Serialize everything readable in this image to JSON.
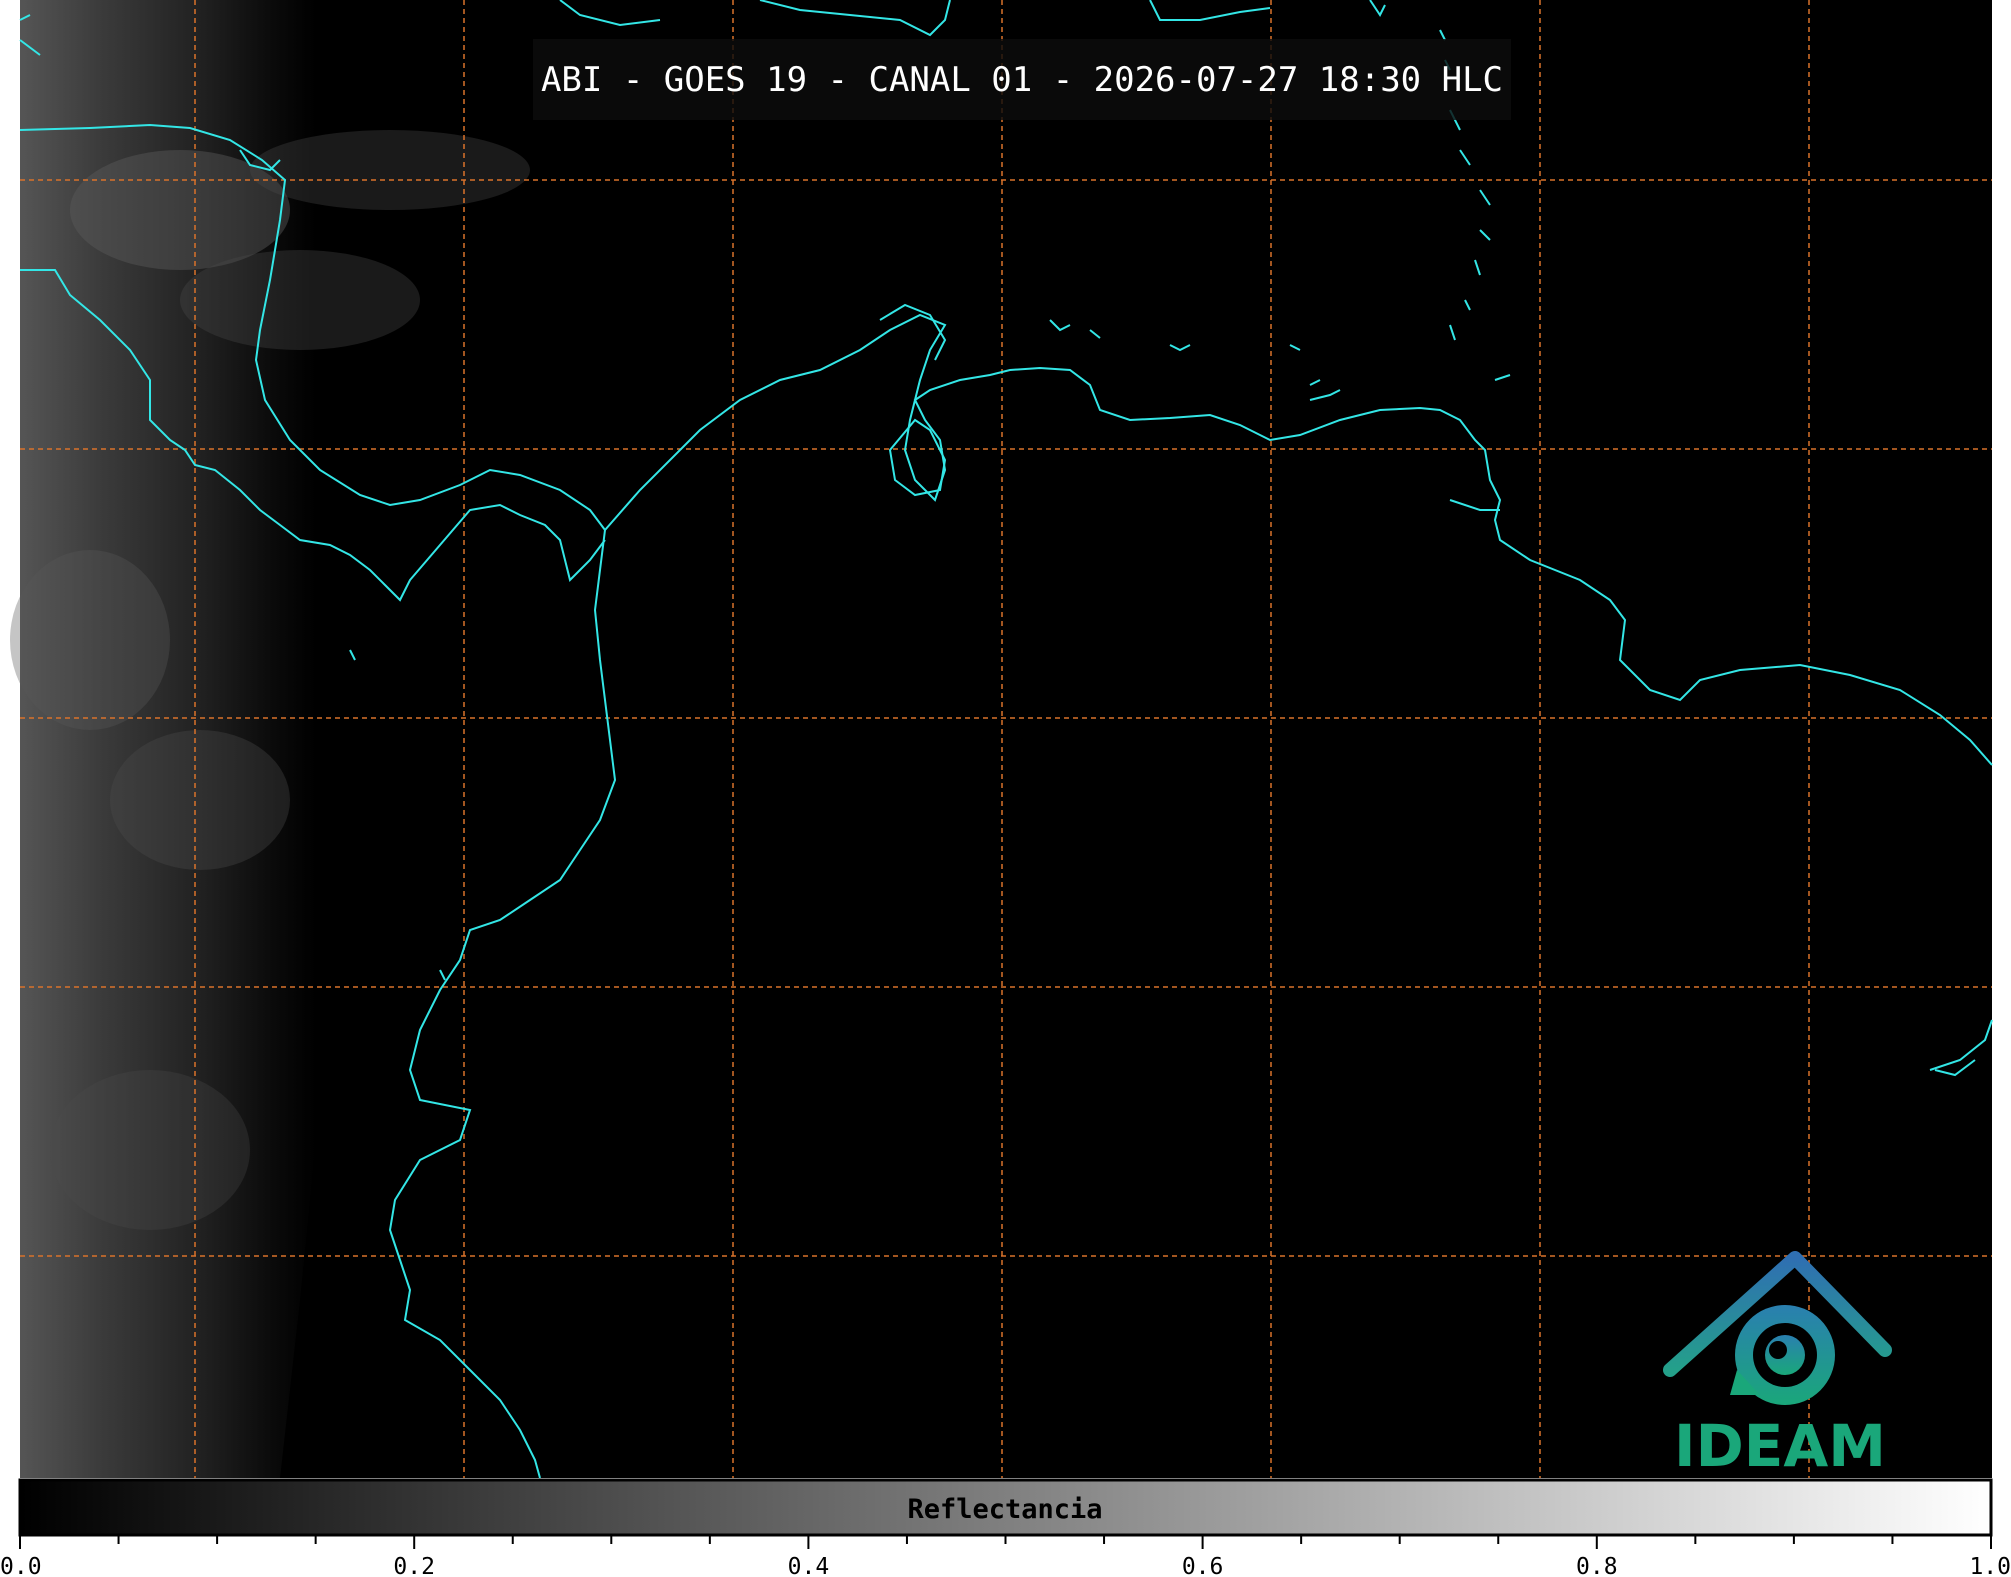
{
  "title": "ABI - GOES 19 - CANAL 01 - 2026-07-27 18:30 HLC",
  "colorbar": {
    "label": "Reflectancia",
    "ticks": [
      "0.0",
      "0.2",
      "0.4",
      "0.6",
      "0.8",
      "1.0"
    ],
    "range": [
      0.0,
      1.0
    ],
    "gradient": [
      "#000000",
      "#ffffff"
    ]
  },
  "logo": {
    "text": "IDEAM",
    "color_primary": "#1aa77a",
    "color_secondary": "#2b6fb0"
  },
  "colors": {
    "coastline": "#33e6e6",
    "grid": "#d9722b",
    "background": "#000000"
  },
  "icons": [
    "ideam-logo-icon"
  ]
}
